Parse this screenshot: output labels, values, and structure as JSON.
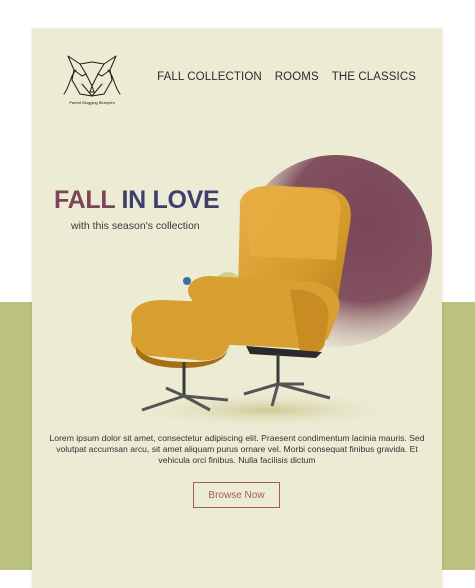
{
  "brand": {
    "logo_text": "Parent Blogging Blueprint",
    "icon": "fox-logo-icon"
  },
  "nav": {
    "items": [
      {
        "label": "FALL COLLECTION"
      },
      {
        "label": "ROOMS"
      },
      {
        "label": "THE CLASSICS"
      }
    ]
  },
  "hero": {
    "title_part1": "FALL",
    "title_part2": "IN LOVE",
    "subtitle": "with this season's collection",
    "product_icon": "lounge-chair-with-ottoman-image"
  },
  "body": {
    "paragraph": "Lorem ipsum dolor sit amet, consectetur adipiscing elit. Praesent condimentum lacinia mauris. Sed volutpat accumsan arcu, sit amet aliquam purus ornare vel. Morbi consequat finibus gravida. Et vehicula orci finibus. Nulla facilisis dictum"
  },
  "cta": {
    "label": "Browse Now"
  },
  "colors": {
    "page_band": "#bac27e",
    "card": "#ecebd3",
    "title_accent": "#7a4658",
    "title_main": "#3e3f6b",
    "button": "#a8585f",
    "circle": "#7a4658",
    "chair": "#d8a02c",
    "dot": "#3b6fa6"
  }
}
